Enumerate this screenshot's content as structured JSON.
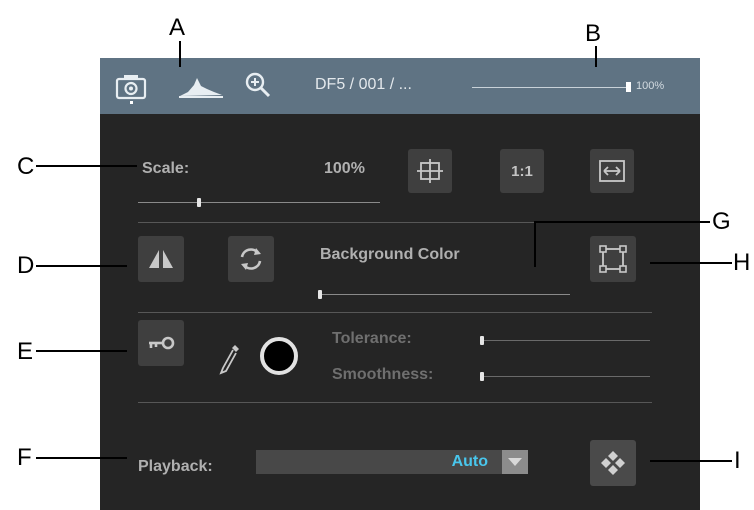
{
  "callouts": {
    "a": "A",
    "b": "B",
    "c": "C",
    "d": "D",
    "e": "E",
    "f": "F",
    "g": "G",
    "h": "H",
    "i": "I"
  },
  "topbar": {
    "breadcrumb": "DF5 / 001 / ...",
    "zoom_text": "100%",
    "zoom_fraction": 1.0,
    "active_tab": "camera",
    "icons": [
      "camera-icon",
      "histogram-icon",
      "zoom-icon"
    ]
  },
  "scale": {
    "label": "Scale:",
    "value_text": "100%",
    "slider_fraction": 0.25,
    "buttons": [
      "fit-frame-icon",
      "1:1",
      "fit-width-icon"
    ],
    "one_to_one_label": "1:1"
  },
  "background": {
    "label": "Background Color",
    "slider_fraction": 0.0,
    "icons": [
      "flip-horizontal-icon",
      "rotate-icon",
      "crop-frame-icon"
    ]
  },
  "keying": {
    "tolerance_label": "Tolerance:",
    "smoothness_label": "Smoothness:",
    "tolerance_fraction": 0.0,
    "smoothness_fraction": 0.0,
    "icons": [
      "key-icon",
      "eyedropper-icon",
      "color-swatch-icon"
    ],
    "swatch_color": "#000000"
  },
  "playback": {
    "label": "Playback:",
    "value": "Auto",
    "icons": [
      "chevron-down-icon",
      "diamond-icon"
    ]
  },
  "colors": {
    "panel_bg": "#252525",
    "topbar_bg": "#5f7383",
    "button_bg": "#3f3f3f",
    "accent": "#49c6ec"
  }
}
